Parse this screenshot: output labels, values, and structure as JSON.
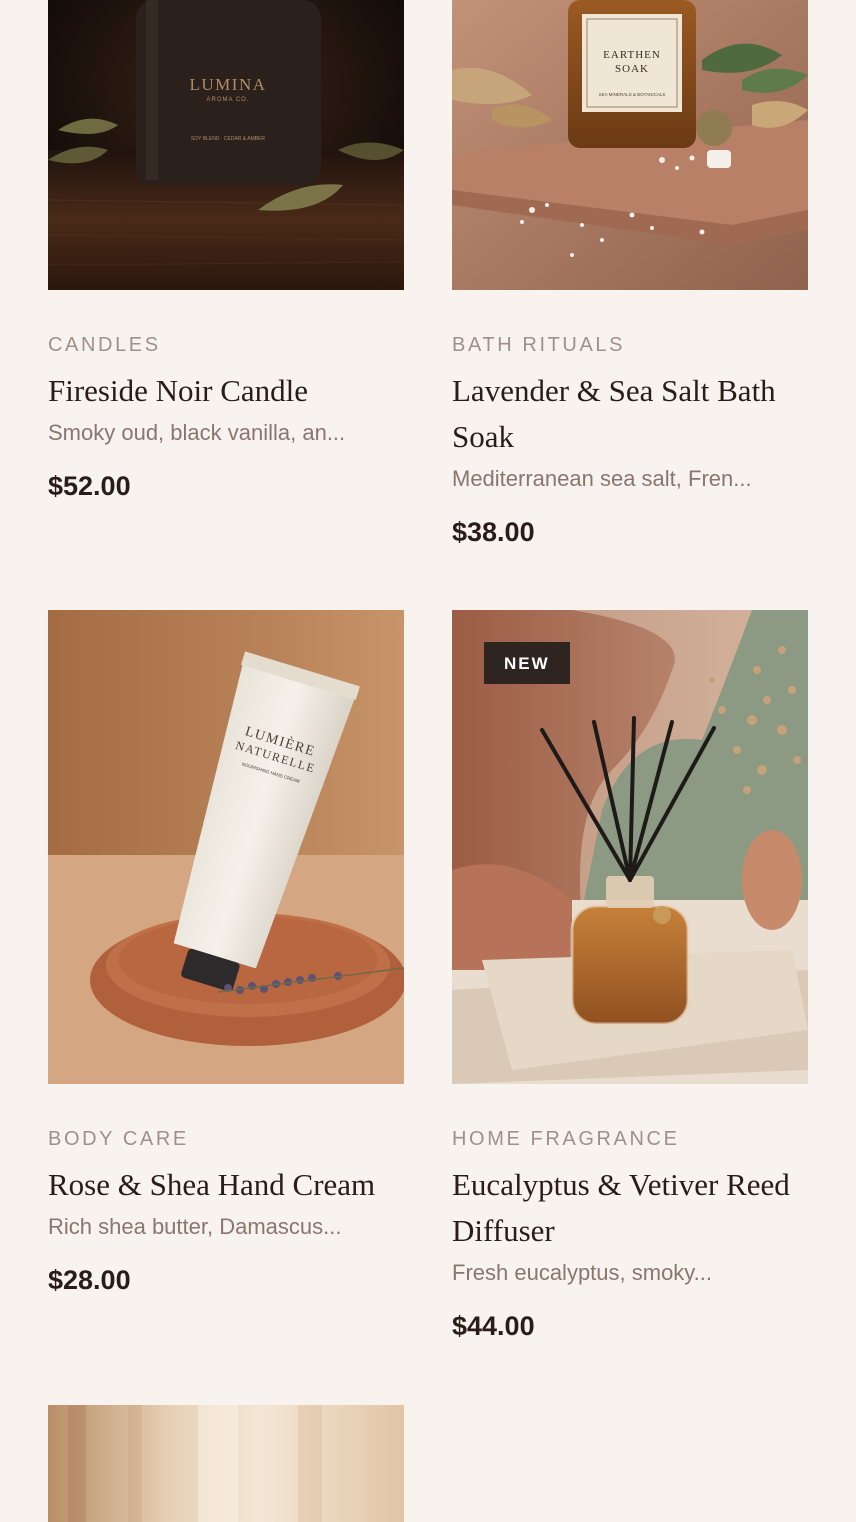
{
  "products": [
    {
      "category": "CANDLES",
      "title": "Fireside Noir Candle",
      "description": "Smoky oud, black vanilla, an...",
      "price": "$52.00",
      "image_label": "LUMINA",
      "image_sublabel": "AROMA CO.",
      "image_note": "SOY BLEND · CEDAR & AMBER"
    },
    {
      "category": "BATH RITUALS",
      "title": "Lavender & Sea Salt Bath Soak",
      "description": "Mediterranean sea salt, Fren...",
      "price": "$38.00",
      "image_label": "EARTHEN",
      "image_sublabel": "SOAK",
      "image_note": "SEA MINERALS & BOTANICALS"
    },
    {
      "category": "BODY CARE",
      "title": "Rose & Shea Hand Cream",
      "description": "Rich shea butter, Damascus...",
      "price": "$28.00",
      "image_label": "LUMIÈRE",
      "image_sublabel": "NATURELLE",
      "image_note": "NOURISHING HAND CREAM"
    },
    {
      "category": "HOME FRAGRANCE",
      "title": "Eucalyptus & Vetiver Reed Diffuser",
      "description": "Fresh eucalyptus, smoky...",
      "price": "$44.00",
      "badge": "NEW"
    }
  ]
}
